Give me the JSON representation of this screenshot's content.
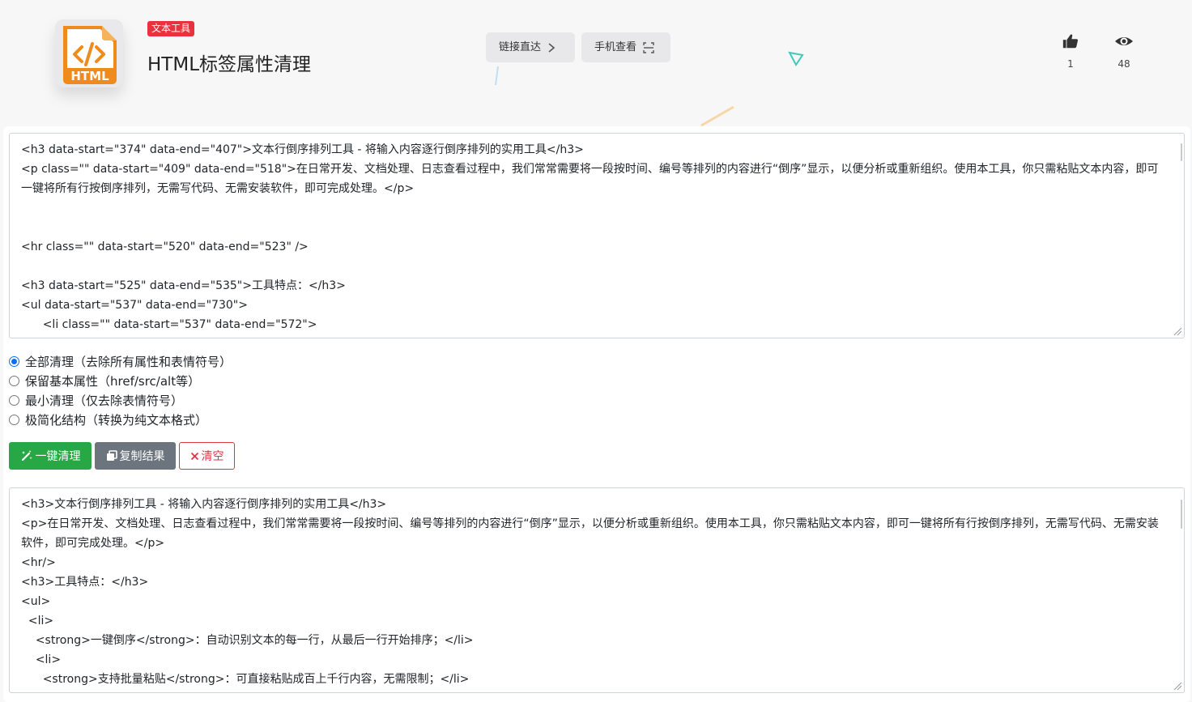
{
  "header": {
    "tag": "文本工具",
    "title": "HTML标签属性清理",
    "logo_text": "HTML",
    "link_button": "链接直达",
    "mobile_button": "手机查看",
    "likes": "1",
    "views": "48"
  },
  "input": {
    "lines": [
      "<h3 data-start=\"374\" data-end=\"407\">文本行倒序排列工具 - 将输入内容逐行倒序排列的实用工具</h3>",
      "<p class=\"\" data-start=\"409\" data-end=\"518\">在日常开发、文档处理、日志查看过程中，我们常常需要将一段按时间、编号等排列的内容进行“倒序”显示，以便分析或重新组织。使用本工具，你只需粘贴文本内容，即可一键将所有行按倒序排列，无需写代码、无需安装软件，即可完成处理。</p>",
      "",
      "",
      "<hr class=\"\" data-start=\"520\" data-end=\"523\" />",
      "",
      "<h3 data-start=\"525\" data-end=\"535\">工具特点：</h3>",
      "<ul data-start=\"537\" data-end=\"730\">",
      "      <li class=\"\" data-start=\"537\" data-end=\"572\">"
    ]
  },
  "options": [
    {
      "label": "全部清理（去除所有属性和表情符号）",
      "checked": true
    },
    {
      "label": "保留基本属性（href/src/alt等）",
      "checked": false
    },
    {
      "label": "最小清理（仅去除表情符号）",
      "checked": false
    },
    {
      "label": "极简化结构（转换为纯文本格式）",
      "checked": false
    }
  ],
  "actions": {
    "clean": "一键清理",
    "copy": "复制结果",
    "clear": "清空"
  },
  "output": {
    "lines": [
      "<h3>文本行倒序排列工具 - 将输入内容逐行倒序排列的实用工具</h3>",
      "<p>在日常开发、文档处理、日志查看过程中，我们常常需要将一段按时间、编号等排列的内容进行“倒序”显示，以便分析或重新组织。使用本工具，你只需粘贴文本内容，即可一键将所有行按倒序排列，无需写代码、无需安装软件，即可完成处理。</p>",
      "<hr/>",
      "<h3>工具特点：</h3>",
      "<ul>",
      "  <li>",
      "    <strong>一键倒序</strong>：自动识别文本的每一行，从最后一行开始排序；</li>",
      "    <li>",
      "      <strong>支持批量粘贴</strong>：可直接粘贴成百上千行内容，无需限制；</li>"
    ]
  },
  "colors": {
    "tag_bg": "#e8333f",
    "clean_btn": "#28a745",
    "copy_btn": "#6c757d",
    "clear_btn": "#dc3545",
    "radio_accent": "#0d6efd"
  }
}
